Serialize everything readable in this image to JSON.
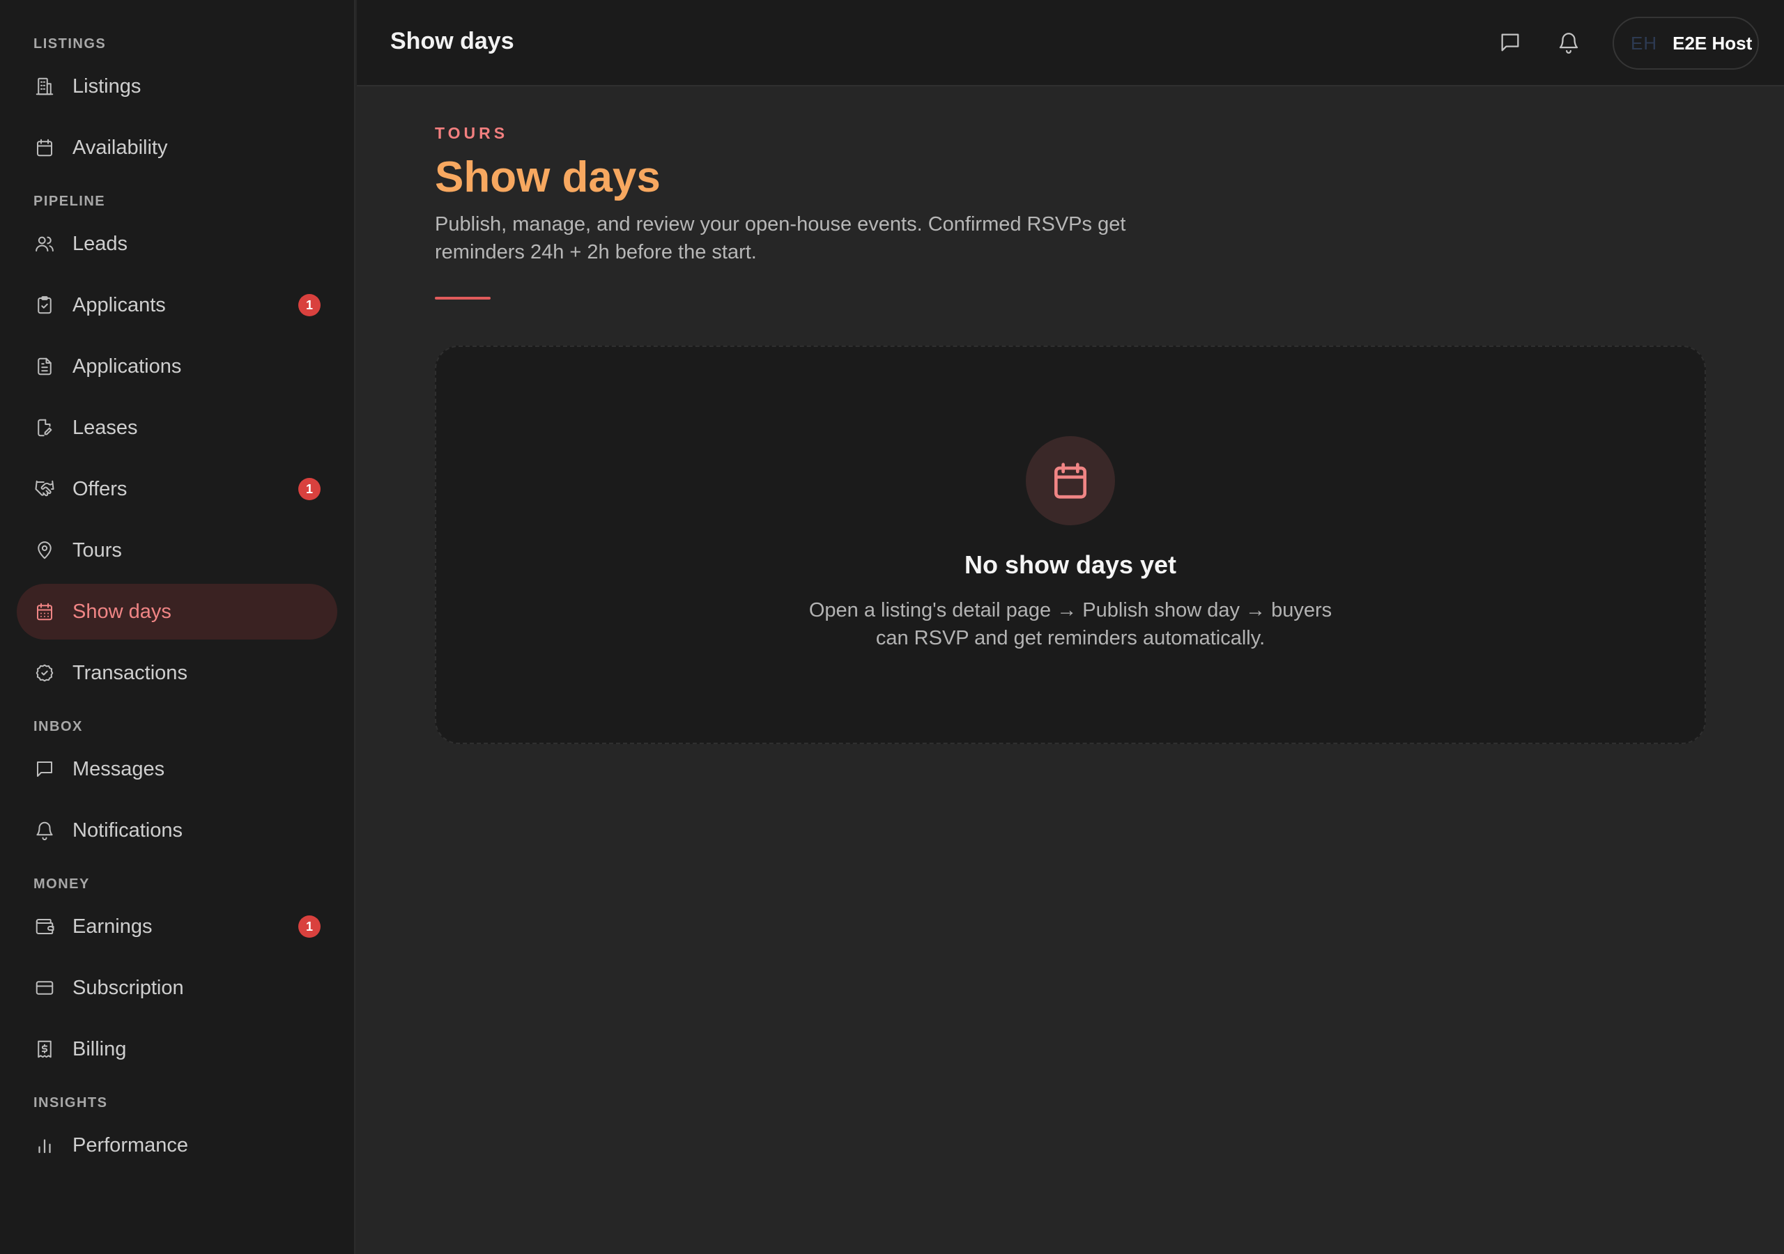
{
  "sidebar": {
    "sections": [
      {
        "label": "LISTINGS",
        "items": [
          {
            "label": "Listings",
            "icon": "building-icon"
          },
          {
            "label": "Availability",
            "icon": "calendar-icon"
          }
        ]
      },
      {
        "label": "PIPELINE",
        "items": [
          {
            "label": "Leads",
            "icon": "users-icon"
          },
          {
            "label": "Applicants",
            "icon": "clipboard-check-icon",
            "badge": "1"
          },
          {
            "label": "Applications",
            "icon": "document-icon"
          },
          {
            "label": "Leases",
            "icon": "document-edit-icon"
          },
          {
            "label": "Offers",
            "icon": "handshake-icon",
            "badge": "1"
          },
          {
            "label": "Tours",
            "icon": "map-pin-icon"
          },
          {
            "label": "Show days",
            "icon": "calendar-days-icon",
            "active": true
          },
          {
            "label": "Transactions",
            "icon": "check-circle-icon"
          }
        ]
      },
      {
        "label": "INBOX",
        "items": [
          {
            "label": "Messages",
            "icon": "message-icon"
          },
          {
            "label": "Notifications",
            "icon": "bell-icon"
          }
        ]
      },
      {
        "label": "MONEY",
        "items": [
          {
            "label": "Earnings",
            "icon": "wallet-icon",
            "badge": "1"
          },
          {
            "label": "Subscription",
            "icon": "credit-card-icon"
          },
          {
            "label": "Billing",
            "icon": "receipt-icon"
          }
        ]
      },
      {
        "label": "INSIGHTS",
        "items": [
          {
            "label": "Performance",
            "icon": "bar-chart-icon"
          }
        ]
      }
    ]
  },
  "topbar": {
    "title": "Show days",
    "user_initials": "EH",
    "user_name": "E2E Host"
  },
  "main": {
    "eyebrow": "TOURS",
    "title": "Show days",
    "description": "Publish, manage, and review your open-house events. Confirmed RSVPs get reminders 24h + 2h before the start."
  },
  "empty_state": {
    "title": "No show days yet",
    "description": "Open a listing's detail page → Publish show day → buyers can RSVP and get reminders automatically."
  },
  "colors": {
    "accent": "#f08585",
    "title_orange": "#f7a860",
    "badge_red": "#d9413e",
    "sidebar_bg": "#1b1b1b",
    "main_bg": "#262626"
  }
}
